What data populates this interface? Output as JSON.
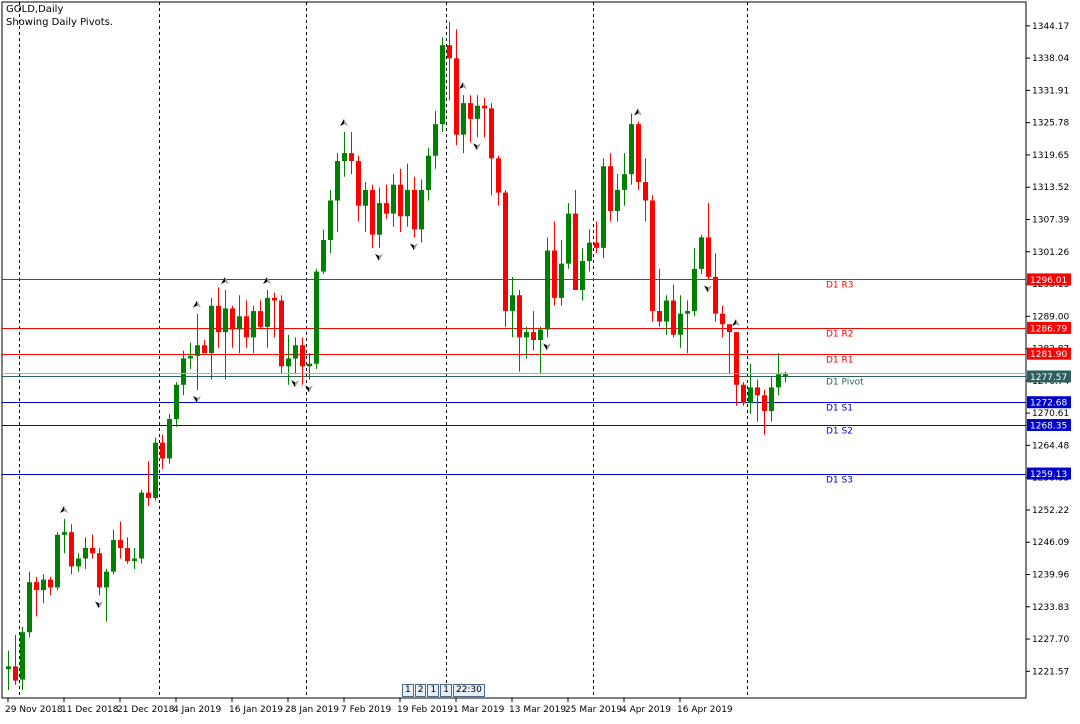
{
  "header": {
    "symbol_line": "GOLD,Daily",
    "indicator_line": "Showing Daily Pivots."
  },
  "colors": {
    "bull": "#008000",
    "bear": "#ff0000",
    "resistance": "#ff0000",
    "support": "#0000cc",
    "pivot": "#2e5e5e",
    "axis": "#000000"
  },
  "timeframe_tabs": [
    "1",
    "2",
    "1",
    "1",
    "22:30"
  ],
  "chart_data": {
    "type": "candlestick",
    "y_axis": {
      "range": [
        1216.5,
        1348.7
      ],
      "tick_labels": [
        "1344.17",
        "1338.04",
        "1331.91",
        "1325.78",
        "1319.65",
        "1313.52",
        "1307.39",
        "1301.26",
        "1295.13",
        "1289.00",
        "1282.87",
        "1276.74",
        "1270.61",
        "1264.48",
        "1258.35",
        "1252.22",
        "1246.09",
        "1239.96",
        "1233.83",
        "1227.70",
        "1221.57"
      ]
    },
    "x_axis": {
      "date_labels": [
        "29 Nov 2018",
        "11 Dec 2018",
        "21 Dec 2018",
        "4 Jan 2019",
        "16 Jan 2019",
        "28 Jan 2019",
        "7 Feb 2019",
        "19 Feb 2019",
        "1 Mar 2019",
        "13 Mar 2019",
        "25 Mar 2019",
        "4 Apr 2019",
        "16 Apr 2019"
      ],
      "label_positions_index": [
        0,
        8,
        16,
        24,
        32,
        40,
        48,
        56,
        64,
        72,
        80,
        88,
        96
      ],
      "period_separator_index": [
        2,
        22,
        43,
        63,
        84,
        106
      ]
    },
    "pivot_levels": [
      {
        "name": "D1 R3",
        "value": 1296.01,
        "role": "resistance"
      },
      {
        "name": "D1 R2",
        "value": 1286.79,
        "role": "resistance"
      },
      {
        "name": "D1 R1",
        "value": 1281.9,
        "role": "resistance"
      },
      {
        "name": "D1 Pivot",
        "value": 1277.57,
        "role": "pivot"
      },
      {
        "name": "D1 S1",
        "value": 1272.68,
        "role": "support"
      },
      {
        "name": "D1 S2",
        "value": 1268.35,
        "role": "support"
      },
      {
        "name": "D1 S3",
        "value": 1259.13,
        "role": "support"
      }
    ],
    "current_price": 1277.57,
    "candles": [
      [
        1222,
        1225.5,
        1218,
        1222.5
      ],
      [
        1222.5,
        1228.5,
        1219,
        1219.8
      ],
      [
        1220,
        1230,
        1218,
        1229
      ],
      [
        1229,
        1240.5,
        1228,
        1238.5
      ],
      [
        1238.5,
        1239.5,
        1232,
        1237
      ],
      [
        1237,
        1240,
        1234.5,
        1239
      ],
      [
        1239,
        1239.5,
        1236,
        1237.5
      ],
      [
        1237.5,
        1248,
        1237,
        1247.5
      ],
      [
        1247.5,
        1250.5,
        1244,
        1248
      ],
      [
        1248,
        1249.5,
        1240,
        1241.5
      ],
      [
        1241.5,
        1244,
        1240.5,
        1243
      ],
      [
        1243,
        1247,
        1241,
        1245
      ],
      [
        1245,
        1247.5,
        1243,
        1244
      ],
      [
        1244,
        1245,
        1236,
        1237.5
      ],
      [
        1237.5,
        1241,
        1231,
        1240.5
      ],
      [
        1240.5,
        1248.5,
        1240,
        1246.5
      ],
      [
        1246.5,
        1250,
        1243,
        1245
      ],
      [
        1245,
        1247,
        1242,
        1242.5
      ],
      [
        1242.5,
        1245,
        1241,
        1243
      ],
      [
        1243,
        1256,
        1242,
        1255.5
      ],
      [
        1255.5,
        1261.5,
        1253,
        1254.5
      ],
      [
        1254.5,
        1266,
        1254,
        1265
      ],
      [
        1265,
        1266.5,
        1260,
        1262
      ],
      [
        1262,
        1270.5,
        1261,
        1269.5
      ],
      [
        1269.5,
        1276.5,
        1268,
        1276
      ],
      [
        1276,
        1282.5,
        1274,
        1281
      ],
      [
        1281,
        1284,
        1279,
        1281.5
      ],
      [
        1281.5,
        1289.5,
        1275,
        1283.5
      ],
      [
        1283.5,
        1284.5,
        1282,
        1282
      ],
      [
        1282,
        1292.5,
        1277,
        1291
      ],
      [
        1291,
        1294.5,
        1283,
        1286
      ],
      [
        1286,
        1294,
        1277,
        1290.5
      ],
      [
        1290.5,
        1291,
        1283,
        1286.5
      ],
      [
        1286.5,
        1293,
        1282,
        1289
      ],
      [
        1289,
        1292,
        1283,
        1285
      ],
      [
        1285,
        1291,
        1282,
        1290
      ],
      [
        1290,
        1292,
        1286.5,
        1287
      ],
      [
        1287,
        1294,
        1283,
        1292.5
      ],
      [
        1292.5,
        1293.5,
        1285,
        1292
      ],
      [
        1292,
        1293,
        1278,
        1279.5
      ],
      [
        1279.5,
        1285.5,
        1276,
        1281
      ],
      [
        1281,
        1285,
        1278,
        1283.5
      ],
      [
        1283.5,
        1285,
        1276,
        1279.5
      ],
      [
        1279.5,
        1282,
        1277,
        1280
      ],
      [
        1280,
        1298,
        1279,
        1297.5
      ],
      [
        1297.5,
        1305.5,
        1297,
        1303.5
      ],
      [
        1303.5,
        1313,
        1301,
        1311
      ],
      [
        1311,
        1320,
        1305,
        1318.5
      ],
      [
        1318.5,
        1324,
        1315.5,
        1320
      ],
      [
        1320,
        1324,
        1316,
        1318.5
      ],
      [
        1318.5,
        1319.5,
        1307,
        1310
      ],
      [
        1310,
        1314.5,
        1305,
        1313
      ],
      [
        1313,
        1314,
        1302,
        1304.5
      ],
      [
        1304.5,
        1313.5,
        1302,
        1310.5
      ],
      [
        1310.5,
        1314,
        1307.5,
        1308.5
      ],
      [
        1308.5,
        1316,
        1306,
        1314
      ],
      [
        1314,
        1317,
        1305,
        1308
      ],
      [
        1308,
        1318,
        1306,
        1313
      ],
      [
        1313,
        1315.5,
        1304,
        1305.5
      ],
      [
        1305.5,
        1315,
        1303,
        1313
      ],
      [
        1313,
        1321,
        1311,
        1319.5
      ],
      [
        1319.5,
        1328,
        1317,
        1325.5
      ],
      [
        1325.5,
        1342,
        1324,
        1340.5
      ],
      [
        1340.5,
        1345,
        1330,
        1338
      ],
      [
        1338,
        1343.5,
        1321.5,
        1323.5
      ],
      [
        1323.5,
        1331,
        1320,
        1329.5
      ],
      [
        1329.5,
        1331,
        1322,
        1326.5
      ],
      [
        1326.5,
        1331,
        1323,
        1329
      ],
      [
        1329,
        1330.5,
        1323,
        1328.5
      ],
      [
        1328.5,
        1329.5,
        1312,
        1319
      ],
      [
        1319,
        1319.5,
        1310,
        1312.5
      ],
      [
        1312.5,
        1313,
        1287,
        1290
      ],
      [
        1290,
        1296.5,
        1285,
        1293
      ],
      [
        1293,
        1294,
        1278.5,
        1285
      ],
      [
        1285,
        1287,
        1281,
        1286
      ],
      [
        1286,
        1290,
        1282.5,
        1284.5
      ],
      [
        1284.5,
        1287,
        1278,
        1286.5
      ],
      [
        1286.5,
        1304,
        1285,
        1301.5
      ],
      [
        1301.5,
        1307,
        1291,
        1292.5
      ],
      [
        1292.5,
        1303.5,
        1291,
        1299
      ],
      [
        1299,
        1310.5,
        1298,
        1308.5
      ],
      [
        1308.5,
        1313,
        1295,
        1294
      ],
      [
        1294,
        1302,
        1292,
        1299.5
      ],
      [
        1299.5,
        1305.5,
        1297.5,
        1303
      ],
      [
        1303,
        1307,
        1301,
        1302
      ],
      [
        1302,
        1319,
        1300,
        1317.5
      ],
      [
        1317.5,
        1320,
        1307,
        1309
      ],
      [
        1309,
        1316,
        1307,
        1313
      ],
      [
        1313,
        1320,
        1310,
        1316
      ],
      [
        1316,
        1327.5,
        1314,
        1325.5
      ],
      [
        1325.5,
        1326,
        1313,
        1314.5
      ],
      [
        1314.5,
        1319,
        1307,
        1311
      ],
      [
        1311,
        1312,
        1288,
        1290
      ],
      [
        1290,
        1298,
        1287,
        1288
      ],
      [
        1288,
        1293,
        1285.5,
        1292
      ],
      [
        1292,
        1295,
        1285,
        1285.5
      ],
      [
        1285.5,
        1293,
        1283,
        1289.5
      ],
      [
        1289.5,
        1292,
        1282,
        1290
      ],
      [
        1290,
        1302,
        1289,
        1298
      ],
      [
        1298,
        1304.5,
        1297,
        1304
      ],
      [
        1304,
        1310.5,
        1296,
        1296.5
      ],
      [
        1296.5,
        1301,
        1288,
        1289.5
      ],
      [
        1289.5,
        1291,
        1285,
        1287.5
      ],
      [
        1287.5,
        1286.5,
        1278,
        1286
      ],
      [
        1286,
        1286,
        1272,
        1276
      ],
      [
        1276,
        1276.5,
        1272,
        1272.5
      ],
      [
        1272.5,
        1280,
        1270.5,
        1275.5
      ],
      [
        1275.5,
        1277,
        1269,
        1274
      ],
      [
        1274,
        1275,
        1266.5,
        1271
      ],
      [
        1271,
        1277.5,
        1269,
        1275.5
      ],
      [
        1275.5,
        1282,
        1274,
        1278
      ],
      [
        1277.5,
        1278.5,
        1276.5,
        1278
      ]
    ],
    "fractals_up": [
      8,
      27,
      31,
      37,
      48,
      65,
      90,
      104,
      114
    ],
    "fractals_down": [
      13,
      27,
      41,
      43,
      53,
      58,
      67,
      77,
      100,
      114
    ]
  }
}
